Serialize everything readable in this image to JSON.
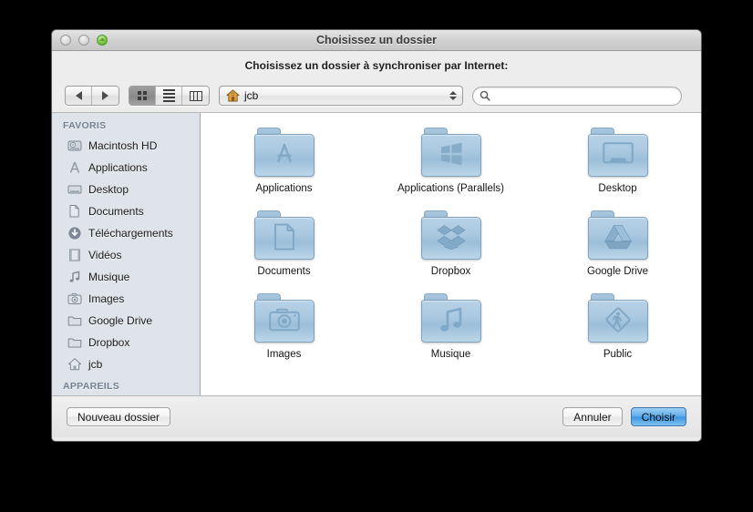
{
  "window": {
    "title": "Choisissez un dossier",
    "prompt": "Choisissez un dossier à synchroniser par Internet:",
    "traffic_lights": [
      "close-button",
      "minimize-button",
      "zoom-button"
    ]
  },
  "toolbar": {
    "back_label": "",
    "forward_label": "",
    "view_modes": [
      {
        "name": "icon-view",
        "selected": true
      },
      {
        "name": "list-view",
        "selected": false
      },
      {
        "name": "column-view",
        "selected": false
      }
    ],
    "path_popup": {
      "label": "jcb",
      "icon": "home-icon"
    },
    "search": {
      "value": "",
      "placeholder": "",
      "icon": "search-icon"
    }
  },
  "sidebar": {
    "sections": [
      {
        "header": "FAVORIS",
        "items": [
          {
            "label": "Macintosh HD",
            "icon": "hard-disk-icon"
          },
          {
            "label": "Applications",
            "icon": "applications-icon"
          },
          {
            "label": "Desktop",
            "icon": "desktop-icon"
          },
          {
            "label": "Documents",
            "icon": "documents-icon"
          },
          {
            "label": "Téléchargements",
            "icon": "downloads-icon"
          },
          {
            "label": "Vidéos",
            "icon": "movies-icon"
          },
          {
            "label": "Musique",
            "icon": "music-icon"
          },
          {
            "label": "Images",
            "icon": "pictures-icon"
          },
          {
            "label": "Google Drive",
            "icon": "folder-icon"
          },
          {
            "label": "Dropbox",
            "icon": "folder-icon"
          },
          {
            "label": "jcb",
            "icon": "home-icon"
          }
        ]
      },
      {
        "header": "APPAREILS",
        "items": []
      }
    ]
  },
  "files": [
    {
      "label": "Applications",
      "glyph": "app-store-glyph"
    },
    {
      "label": "Applications (Parallels)",
      "glyph": "windows-glyph"
    },
    {
      "label": "Desktop",
      "glyph": "monitor-glyph"
    },
    {
      "label": "Documents",
      "glyph": "document-glyph"
    },
    {
      "label": "Dropbox",
      "glyph": "dropbox-glyph"
    },
    {
      "label": "Google Drive",
      "glyph": "drive-glyph"
    },
    {
      "label": "Images",
      "glyph": "camera-glyph"
    },
    {
      "label": "Musique",
      "glyph": "note-glyph"
    },
    {
      "label": "Public",
      "glyph": "pedestrian-glyph"
    }
  ],
  "bottom_bar": {
    "new_folder_label": "Nouveau dossier",
    "cancel_label": "Annuler",
    "choose_label": "Choisir"
  },
  "colors": {
    "accent_button": "#62aeea",
    "folder_blue": "#a9c8e0",
    "sidebar_bg": "#dfe4ea",
    "window_bg": "#ececec",
    "backdrop": "#000000"
  }
}
